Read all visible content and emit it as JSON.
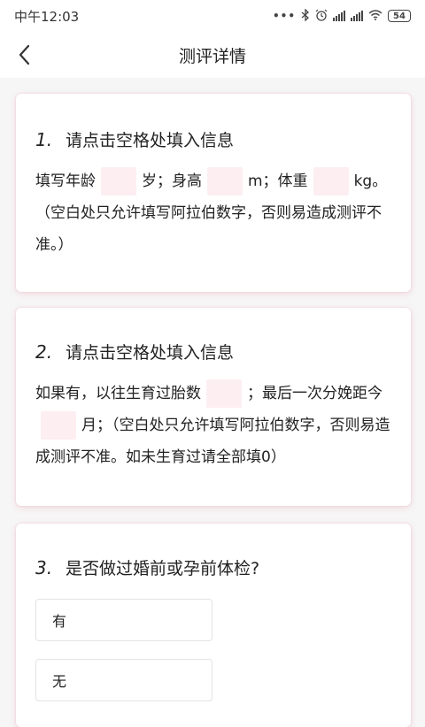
{
  "status_bar": {
    "time": "中午12:03",
    "battery": "54",
    "icons": [
      "more-dots-icon",
      "bluetooth-icon",
      "alarm-icon",
      "signal-icon",
      "hd-signal-icon",
      "wifi-icon",
      "battery-icon"
    ]
  },
  "nav": {
    "title": "测评详情",
    "back_icon": "chevron-left-icon"
  },
  "questions": [
    {
      "number": "1.",
      "title": "请点击空格处填入信息",
      "text": {
        "age_label": "填写年龄",
        "age_unit": "岁；身高",
        "height_unit": "m；体重",
        "weight_unit": "kg。（空白处只允许填写阿拉伯数字，否则易造成测评不准。）"
      },
      "inputs": {
        "age": "",
        "height": "",
        "weight": ""
      }
    },
    {
      "number": "2.",
      "title": "请点击空格处填入信息",
      "text": {
        "births_label": "如果有，以往生育过胎数",
        "births_after": "；最后一次分娩距今",
        "months_after": "月；（空白处只允许填写阿拉伯数字，否则易造成测评不准。如未生育过请全部填0）"
      },
      "inputs": {
        "births": "",
        "months": ""
      }
    },
    {
      "number": "3.",
      "title": "是否做过婚前或孕前体检?",
      "options": [
        "有",
        "无"
      ]
    }
  ],
  "colors": {
    "blank_fill": "#fdeef1",
    "card_shadow": "#f3c2cd",
    "background": "#f6f6f6"
  }
}
